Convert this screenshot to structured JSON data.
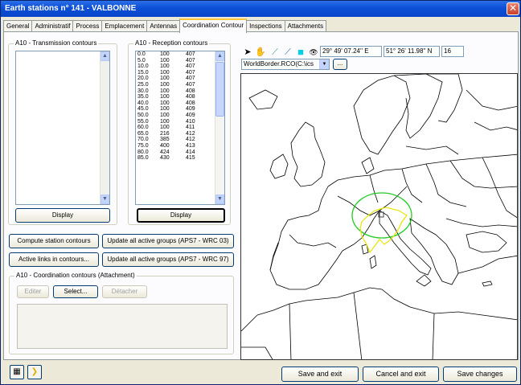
{
  "window": {
    "title": "Earth stations n° 141 - VALBONNE",
    "close": "✕"
  },
  "tabs": [
    {
      "label": "General"
    },
    {
      "label": "Administratif"
    },
    {
      "label": "Process"
    },
    {
      "label": "Emplacement"
    },
    {
      "label": "Antennas"
    },
    {
      "label": "Coordination Contour"
    },
    {
      "label": "Inspections"
    },
    {
      "label": "Attachments"
    }
  ],
  "transmission": {
    "title": "A10 - Transmission contours",
    "display_label": "Display"
  },
  "reception": {
    "title": "A10 - Reception contours",
    "display_label": "Display",
    "rows": [
      {
        "a": "0.0",
        "b": "100",
        "c": "407"
      },
      {
        "a": "5.0",
        "b": "100",
        "c": "407"
      },
      {
        "a": "10.0",
        "b": "100",
        "c": "407"
      },
      {
        "a": "15.0",
        "b": "100",
        "c": "407"
      },
      {
        "a": "20.0",
        "b": "100",
        "c": "407"
      },
      {
        "a": "25.0",
        "b": "100",
        "c": "407"
      },
      {
        "a": "30.0",
        "b": "100",
        "c": "408"
      },
      {
        "a": "35.0",
        "b": "100",
        "c": "408"
      },
      {
        "a": "40.0",
        "b": "100",
        "c": "408"
      },
      {
        "a": "45.0",
        "b": "100",
        "c": "409"
      },
      {
        "a": "50.0",
        "b": "100",
        "c": "409"
      },
      {
        "a": "55.0",
        "b": "100",
        "c": "410"
      },
      {
        "a": "60.0",
        "b": "100",
        "c": "411"
      },
      {
        "a": "65.0",
        "b": "216",
        "c": "412"
      },
      {
        "a": "70.0",
        "b": "385",
        "c": "412"
      },
      {
        "a": "75.0",
        "b": "400",
        "c": "413"
      },
      {
        "a": "80.0",
        "b": "424",
        "c": "414"
      },
      {
        "a": "85.0",
        "b": "430",
        "c": "415"
      }
    ]
  },
  "actions": {
    "compute": "Compute station contours",
    "update_03": "Update all active groups (APS7 - WRC 03)",
    "active_links": "Active links in contours...",
    "update_97": "Update all active groups (APS7 - WRC 97)"
  },
  "attachment": {
    "title": "A10 - Coordination contours (Attachment)",
    "edit": "Editer",
    "select": "Select...",
    "detach": "Détacher"
  },
  "map_toolbar": {
    "longitude": "29° 49' 07.24'' E",
    "latitude": "51° 26' 11.98'' N",
    "zoom": "16",
    "layer": "WorldBorder.RCO(C:\\ics",
    "layer_button": "..."
  },
  "icons": {
    "pointer": "➤",
    "hand": "✋",
    "draw1": "⟋",
    "draw2": "⟋",
    "color": "■",
    "eye": "👁",
    "calc": "▦",
    "note": "❯"
  },
  "bottom": {
    "save_exit": "Save and exit",
    "cancel_exit": "Cancel and exit",
    "save_changes": "Save changes"
  },
  "colors": {
    "green_contour": "#22cc22",
    "yellow_contour": "#e6e600",
    "accent": "#0b4fd6"
  }
}
